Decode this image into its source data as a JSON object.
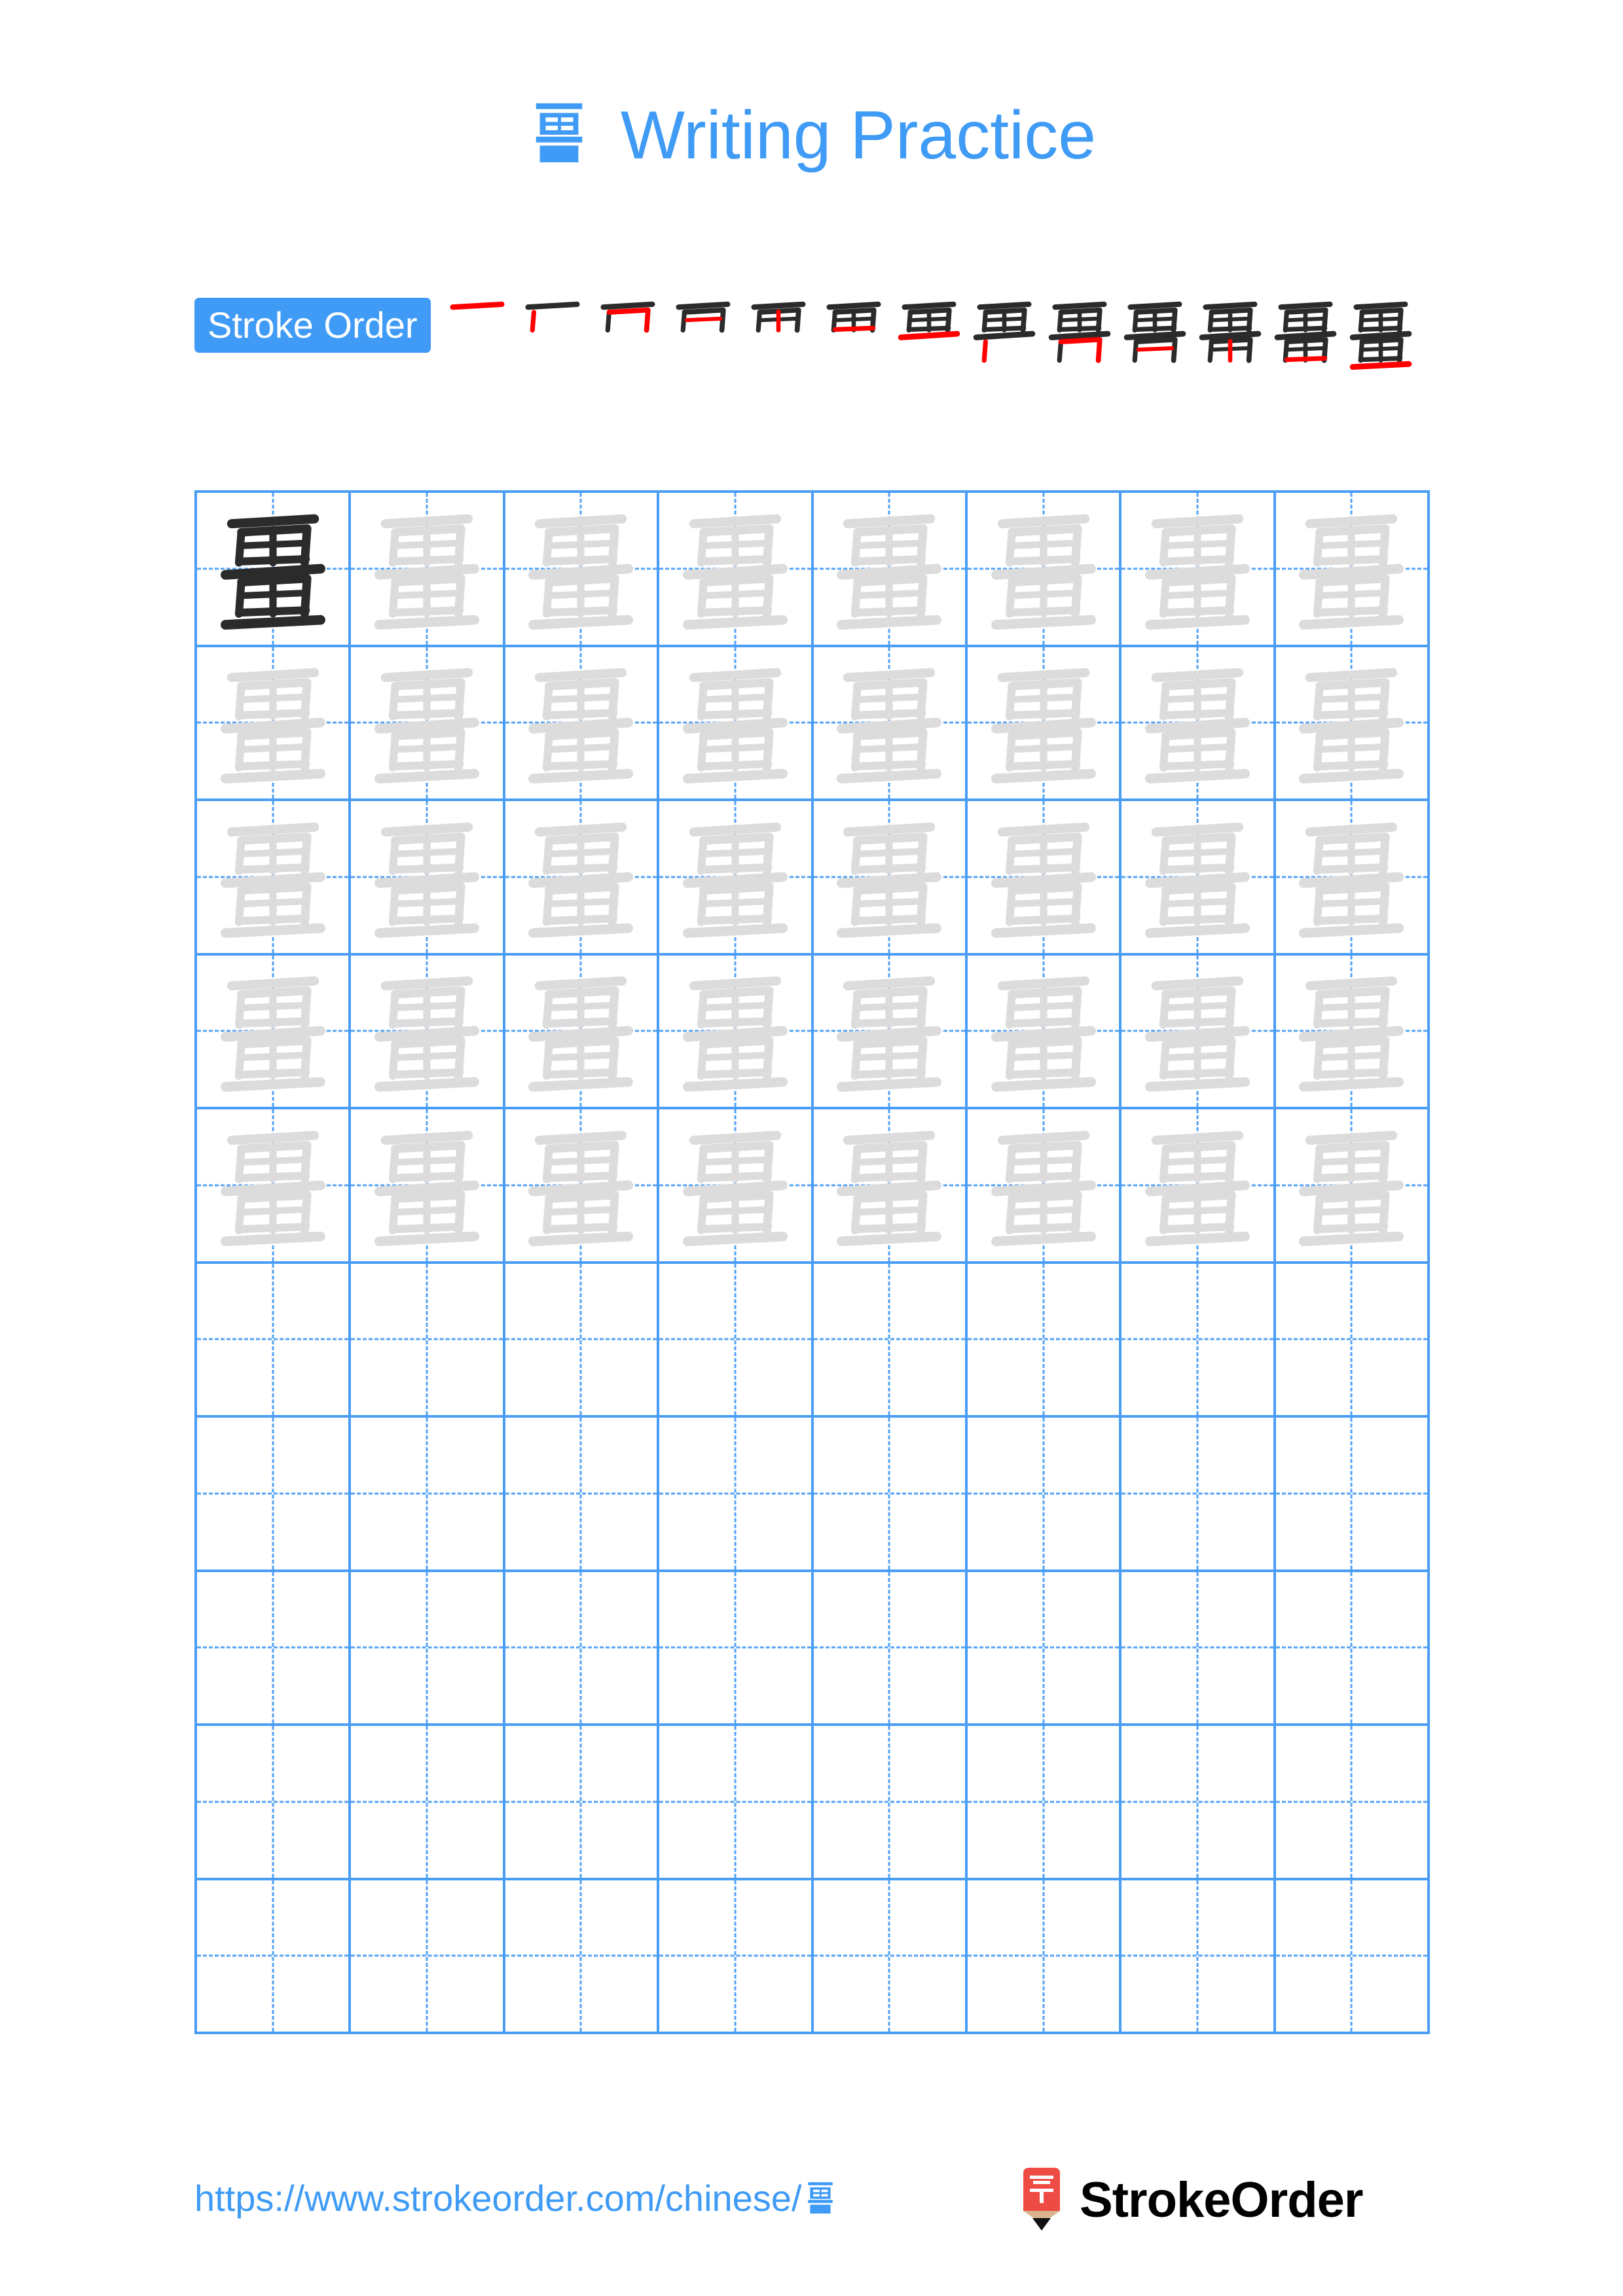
{
  "page": {
    "character": "畺",
    "title_suffix": "Writing Practice",
    "accent_color": "#3f9bf5",
    "grid_line_color": "#4a9df4",
    "trace_color": "#dcdcdc",
    "model_color": "#2b2b2b",
    "new_stroke_color": "#ff0000",
    "background": "#ffffff"
  },
  "stroke_order": {
    "label": "Stroke Order",
    "total_strokes": 13,
    "steps": [
      1,
      2,
      3,
      4,
      5,
      6,
      7,
      8,
      9,
      10,
      11,
      12,
      13
    ]
  },
  "practice_grid": {
    "columns": 8,
    "rows": 10,
    "model_cells": 1,
    "trace_rows": 5,
    "blank_rows": 5
  },
  "footer": {
    "url_text": "https://www.strokeorder.com/chinese/",
    "url_char": "畺",
    "brand_name": "StrokeOrder",
    "brand_mark_char": "字",
    "brand_mark_color": "#ef4b45",
    "brand_pencil_wood": "#d9b48f"
  }
}
